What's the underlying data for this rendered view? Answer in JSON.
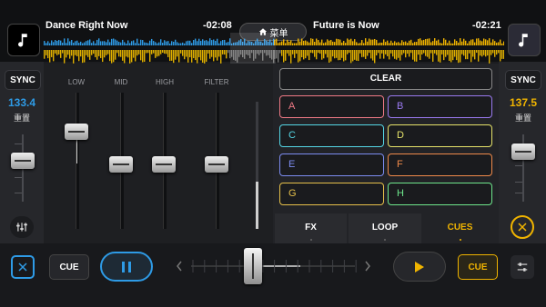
{
  "deck_a": {
    "track_title": "Dance Right Now",
    "time_remaining": "-02:08",
    "sync_label": "SYNC",
    "bpm": "133.4",
    "reset_label": "重置",
    "cue_label": "CUE",
    "accent": "#2e9be6"
  },
  "deck_b": {
    "track_title": "Future is Now",
    "time_remaining": "-02:21",
    "sync_label": "SYNC",
    "bpm": "137.5",
    "reset_label": "重置",
    "cue_label": "CUE",
    "accent": "#f0b400"
  },
  "menu": {
    "label": "菜单",
    "icon": "home-icon"
  },
  "mixer": {
    "labels": {
      "low": "LOW",
      "mid": "MID",
      "high": "HIGH",
      "filter": "FILTER"
    }
  },
  "pads": {
    "clear_label": "CLEAR",
    "items": [
      {
        "label": "A",
        "color": "#f07a86"
      },
      {
        "label": "B",
        "color": "#9a7af0"
      },
      {
        "label": "C",
        "color": "#55d7e6"
      },
      {
        "label": "D",
        "color": "#e6e36a"
      },
      {
        "label": "E",
        "color": "#7c8cf0"
      },
      {
        "label": "F",
        "color": "#f08a4a"
      },
      {
        "label": "G",
        "color": "#e6c04a"
      },
      {
        "label": "H",
        "color": "#6ee68c"
      }
    ]
  },
  "tabs": [
    {
      "label": "FX",
      "active": false
    },
    {
      "label": "LOOP",
      "active": false
    },
    {
      "label": "CUES",
      "active": true,
      "color": "#f0b400"
    }
  ]
}
